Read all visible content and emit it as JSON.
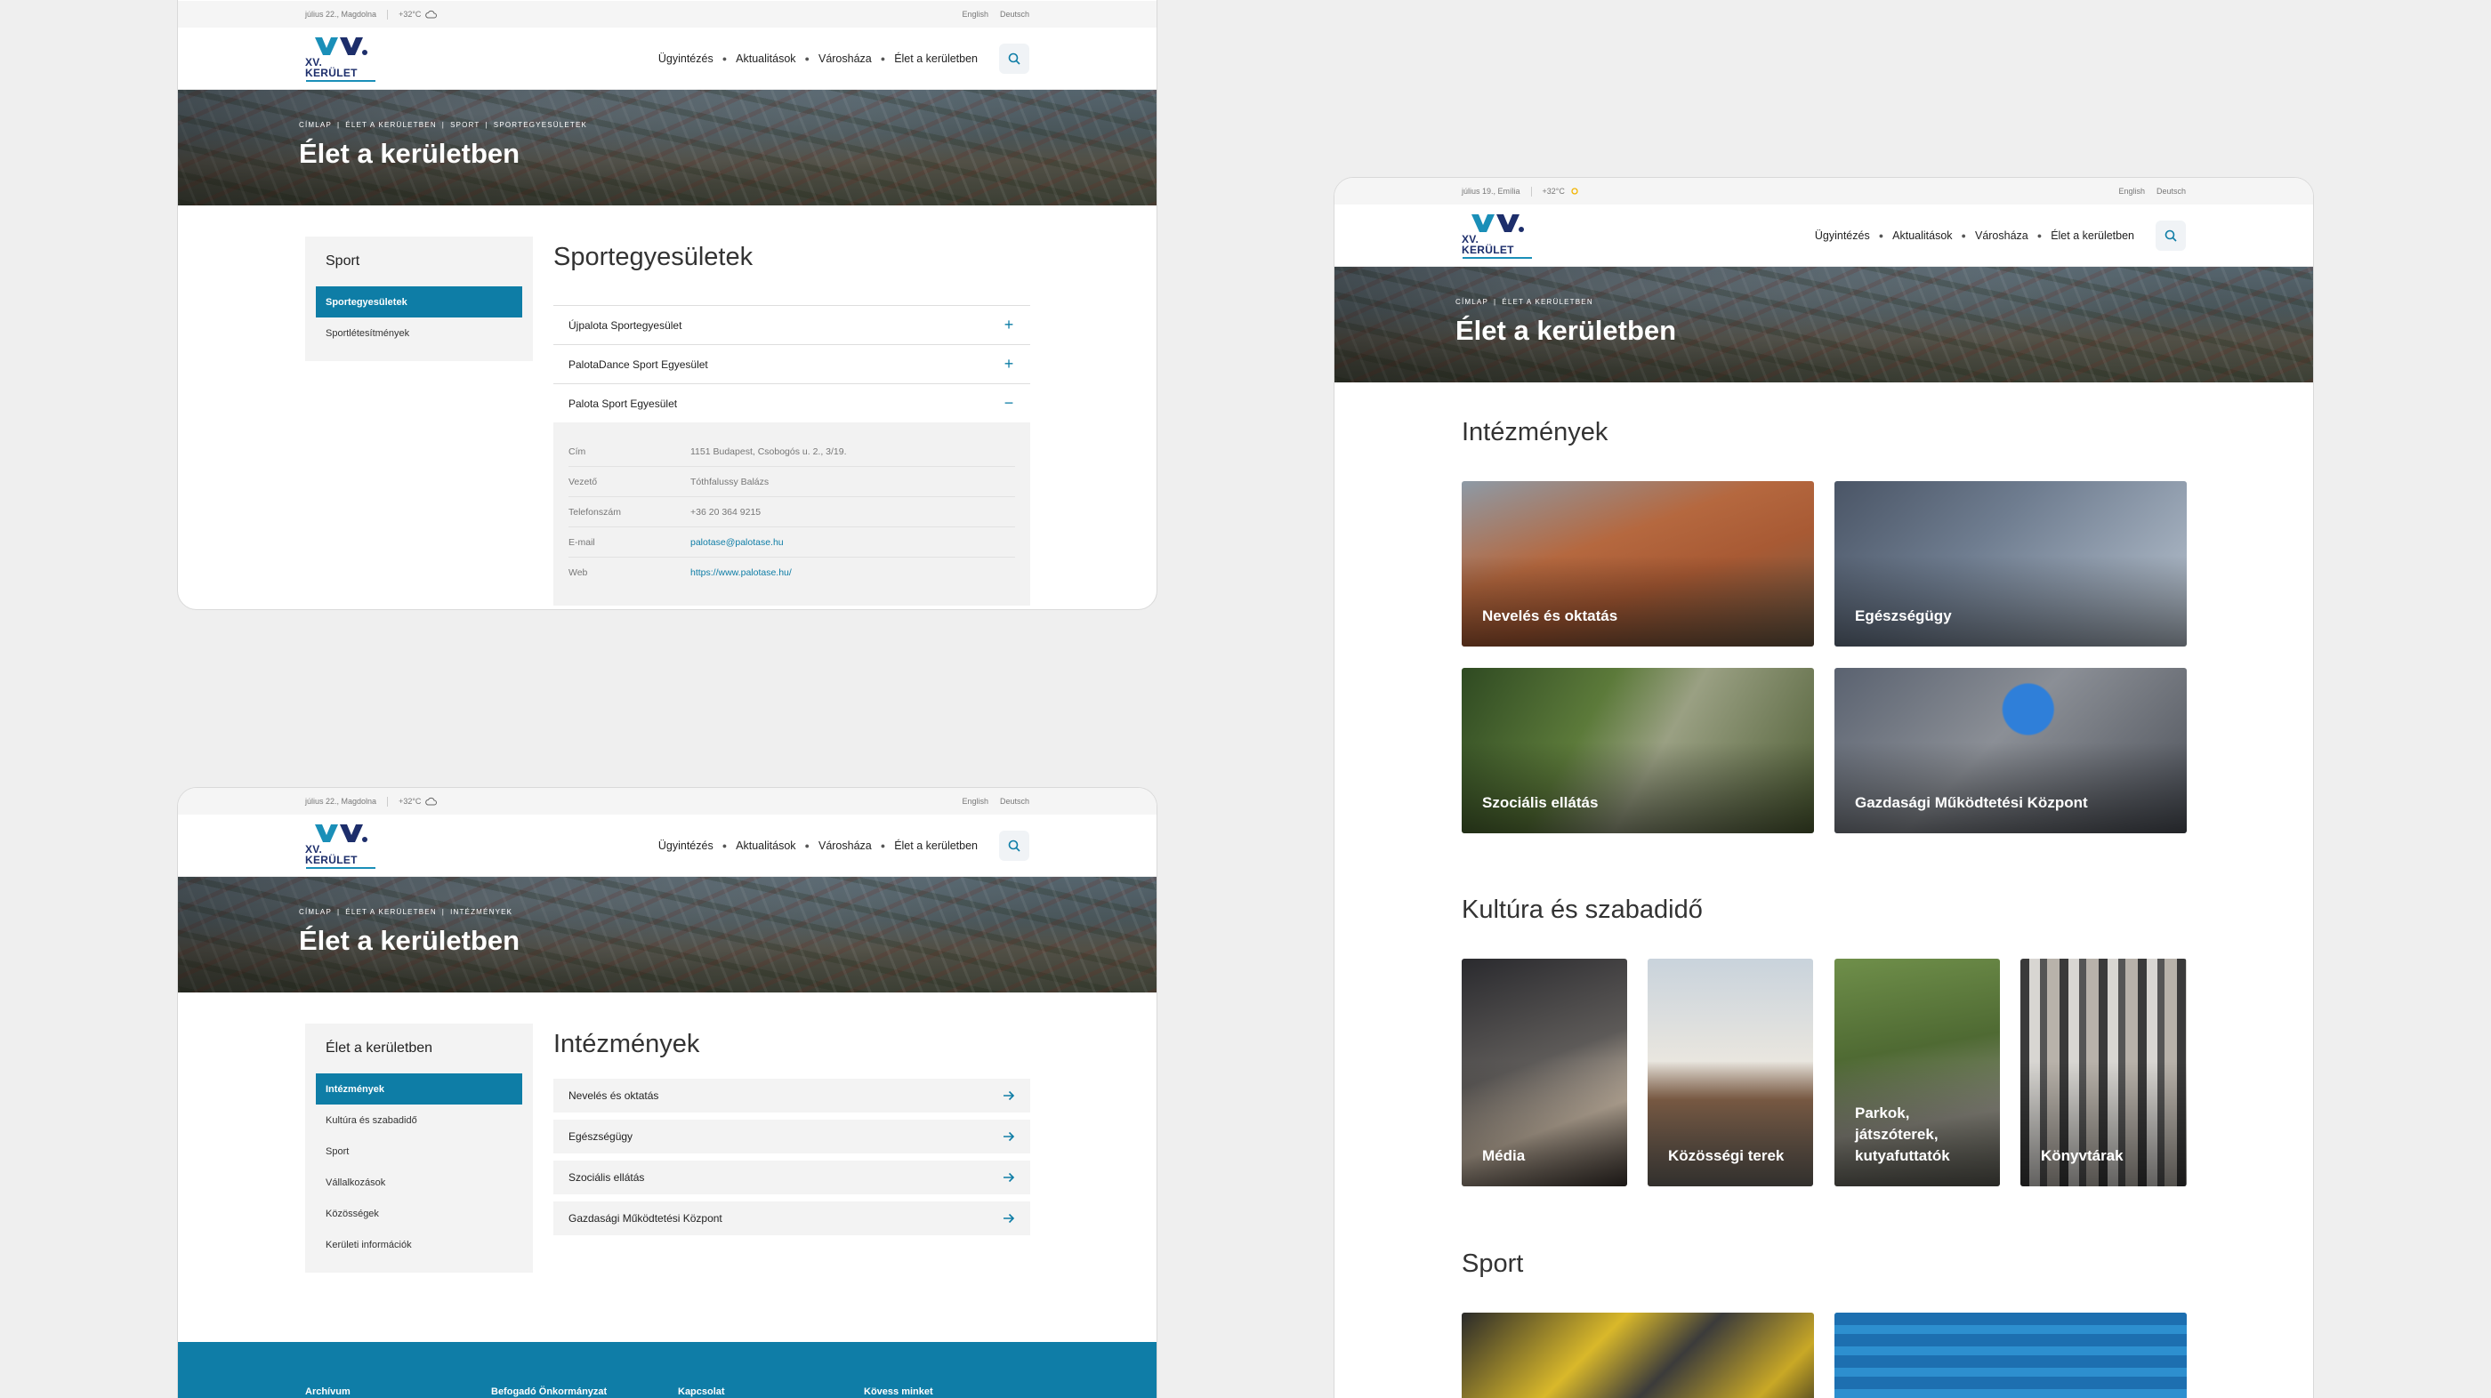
{
  "screen1": {
    "info_bar": {
      "date": "július 22., Magdolna",
      "temp": "+32°C",
      "lang_en": "English",
      "lang_de": "Deutsch"
    },
    "logo_text": "XV. KERÜLET",
    "nav": [
      "Ügyintézés",
      "Aktualitások",
      "Városháza",
      "Élet a kerületben"
    ],
    "breadcrumb": [
      "CÍMLAP",
      "|",
      "ÉLET A KERÜLETBEN",
      "|",
      "SPORT",
      "|",
      "SPORTEGYESÜLETEK"
    ],
    "hero_title": "Élet a kerületben",
    "sidebar": {
      "title": "Sport",
      "items": [
        "Sportegyesületek",
        "Sportlétesítmények"
      ]
    },
    "page_title": "Sportegyesületek",
    "accordion": [
      {
        "label": "Újpalota Sportegyesület",
        "icon": "+"
      },
      {
        "label": "PalotaDance Sport Egyesület",
        "icon": "+"
      },
      {
        "label": "Palota Sport Egyesület",
        "icon": "−"
      }
    ],
    "details": [
      {
        "k": "Cím",
        "v": "1151 Budapest, Csobogós u. 2., 3/19."
      },
      {
        "k": "Vezető",
        "v": "Tóthfalussy Balázs"
      },
      {
        "k": "Telefonszám",
        "v": "+36 20 364 9215"
      },
      {
        "k": "E-mail",
        "v": "palotase@palotase.hu"
      },
      {
        "k": "Web",
        "v": "https://www.palotase.hu/"
      }
    ]
  },
  "screen2": {
    "info_bar": {
      "date": "július 19., Emília",
      "temp": "+32°C",
      "lang_en": "English",
      "lang_de": "Deutsch"
    },
    "logo_text": "XV. KERÜLET",
    "nav": [
      "Ügyintézés",
      "Aktualitások",
      "Városháza",
      "Élet a kerületben"
    ],
    "breadcrumb": [
      "CÍMLAP",
      "|",
      "ÉLET A KERÜLETBEN"
    ],
    "hero_title": "Élet a kerületben",
    "sections": {
      "intezmenyek": {
        "title": "Intézmények",
        "cards": [
          "Nevelés és oktatás",
          "Egészségügy",
          "Szociális ellátás",
          "Gazdasági Működtetési Központ"
        ]
      },
      "kultura": {
        "title": "Kultúra és szabadidő",
        "cards": [
          "Média",
          "Közösségi terek",
          "Parkok, játszóterek, kutyafuttatók",
          "Könyvtárak"
        ]
      },
      "sport": {
        "title": "Sport"
      }
    }
  },
  "screen3": {
    "info_bar": {
      "date": "július 22., Magdolna",
      "temp": "+32°C",
      "lang_en": "English",
      "lang_de": "Deutsch"
    },
    "logo_text": "XV. KERÜLET",
    "nav": [
      "Ügyintézés",
      "Aktualitások",
      "Városháza",
      "Élet a kerületben"
    ],
    "breadcrumb": [
      "CÍMLAP",
      "|",
      "ÉLET A KERÜLETBEN",
      "|",
      "INTÉZMÉNYEK"
    ],
    "hero_title": "Élet a kerületben",
    "sidebar": {
      "title": "Élet a kerületben",
      "items": [
        "Intézmények",
        "Kultúra és szabadidő",
        "Sport",
        "Vállalkozások",
        "Közösségek",
        "Kerületi információk"
      ]
    },
    "page_title": "Intézmények",
    "list": [
      "Nevelés és oktatás",
      "Egészségügy",
      "Szociális ellátás",
      "Gazdasági Működtetési Központ"
    ],
    "footer": [
      "Archívum",
      "Befogadó Önkormányzat",
      "Kapcsolat",
      "Kövess minket"
    ]
  },
  "colors": {
    "accent": "#0e7da6",
    "footer": "#0f7da7",
    "logo_dark": "#1d2e6b"
  },
  "icons": {
    "weather": "cloud-icon",
    "weather_sun": "sun-icon",
    "search": "search-icon",
    "arrow": "arrow-right-icon"
  }
}
